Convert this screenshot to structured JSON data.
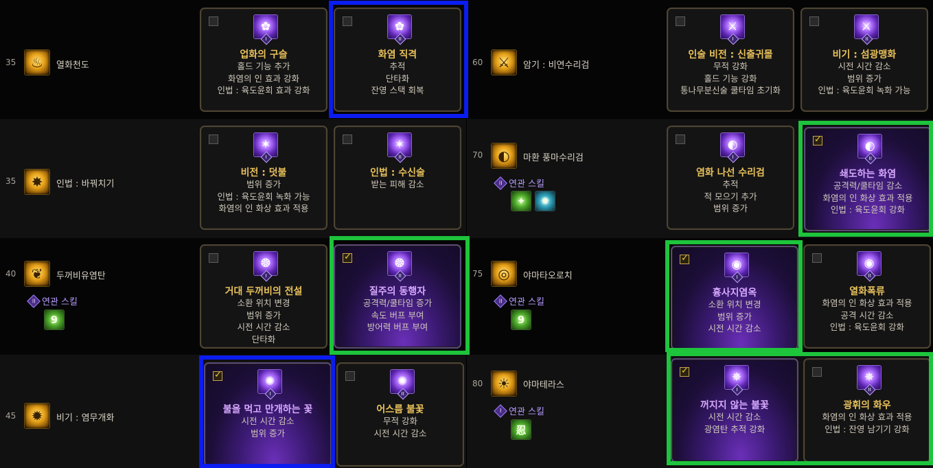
{
  "colors": {
    "highlight_blue": "#0b1cf0",
    "highlight_green": "#1ec43c",
    "title_gold": "#e8c15a",
    "title_selected": "#d7a8ff",
    "related_purple": "#b79cff"
  },
  "left": {
    "rows": [
      {
        "level": "35",
        "skill": "열화천도",
        "icon": "fire-skill-icon",
        "cards": [
          {
            "title": "업화의 구슬",
            "rank": "I",
            "checked": false,
            "selected": false,
            "lines": [
              "홀드 기능 추가",
              "화염의 인 효과 강화",
              "인법 : 육도윤회 효과 강화"
            ]
          },
          {
            "title": "화염 직격",
            "rank": "II",
            "checked": false,
            "selected": false,
            "lines": [
              "추적",
              "단타화",
              "잔영 스택 회복"
            ]
          }
        ]
      },
      {
        "level": "35",
        "skill": "인법 : 바꿔치기",
        "icon": "swap-skill-icon",
        "cards": [
          {
            "title": "비전 : 덧불",
            "rank": "I",
            "checked": false,
            "selected": false,
            "lines": [
              "범위 증가",
              "인법 : 육도윤회 녹화 가능",
              "화염의 인 화상 효과 적용"
            ]
          },
          {
            "title": "인법 : 수신술",
            "rank": "II",
            "checked": false,
            "selected": false,
            "lines": [
              "받는 피해 감소"
            ]
          }
        ]
      },
      {
        "level": "40",
        "skill": "두꺼비유염탄",
        "icon": "toad-skill-icon",
        "related_label": "연관 스킬",
        "related_rank": "II",
        "related_icons": [
          "9"
        ],
        "cards": [
          {
            "title": "거대 두꺼비의 전설",
            "rank": "I",
            "checked": false,
            "selected": false,
            "lines": [
              "소환 위치 변경",
              "범위 증가",
              "시전 시간 감소",
              "단타화"
            ]
          },
          {
            "title": "질주의 동행자",
            "rank": "II",
            "checked": true,
            "selected": true,
            "lines": [
              "공격력/쿨타임 증가",
              "속도 버프 부여",
              "방어력 버프 부여"
            ]
          }
        ]
      },
      {
        "level": "45",
        "skill": "비기 : 염무개화",
        "icon": "bloom-skill-icon",
        "cards": [
          {
            "title": "불을 먹고 만개하는 꽃",
            "rank": "I",
            "checked": true,
            "selected": true,
            "lines": [
              "시전 시간 감소",
              "범위 증가"
            ]
          },
          {
            "title": "어스름 불꽃",
            "rank": "II",
            "checked": false,
            "selected": false,
            "lines": [
              "무적 강화",
              "시전 시간 감소"
            ]
          }
        ]
      }
    ]
  },
  "right": {
    "rows": [
      {
        "level": "60",
        "skill": "암기 : 비연수리검",
        "icon": "shuriken-skill-icon",
        "cards": [
          {
            "title": "인술 비전 : 신출귀몰",
            "rank": "I",
            "checked": false,
            "selected": false,
            "lines": [
              "무적 강화",
              "홀드 기능 강화",
              "통나무분신술 쿨타임 초기화"
            ]
          },
          {
            "title": "비기 : 섬광맹화",
            "rank": "II",
            "checked": false,
            "selected": false,
            "lines": [
              "시전 시간 감소",
              "범위 증가",
              "인법 : 육도윤회 녹화 가능"
            ]
          }
        ]
      },
      {
        "level": "70",
        "skill": "마환 풍마수리검",
        "icon": "wind-shuriken-skill-icon",
        "related_label": "연관 스킬",
        "related_rank": "II",
        "related_icons": [
          "✦",
          "✺"
        ],
        "cards": [
          {
            "title": "염화 나선 수리검",
            "rank": "I",
            "checked": false,
            "selected": false,
            "lines": [
              "추적",
              "적 모으기 추가",
              "범위 증가"
            ]
          },
          {
            "title": "쇄도하는 화염",
            "rank": "II",
            "checked": true,
            "selected": true,
            "lines": [
              "공격력/쿨타임 감소",
              "화염의 인 화상 효과 적용",
              "인법 : 육도윤회 강화"
            ]
          }
        ]
      },
      {
        "level": "75",
        "skill": "야마타오로치",
        "icon": "serpent-skill-icon",
        "related_label": "연관 스킬",
        "related_rank": "II",
        "related_icons": [
          "9"
        ],
        "cards": [
          {
            "title": "흉사지염옥",
            "rank": "I",
            "checked": true,
            "selected": true,
            "lines": [
              "소환 위치 변경",
              "범위 증가",
              "시전 시간 감소"
            ]
          },
          {
            "title": "열화폭류",
            "rank": "II",
            "checked": false,
            "selected": false,
            "lines": [
              "화염의 인 화상 효과 적용",
              "공격 시간 감소",
              "인법 : 육도윤회 강화"
            ]
          }
        ]
      },
      {
        "level": "80",
        "skill": "야마테라스",
        "icon": "sun-skill-icon",
        "related_label": "연관 스킬",
        "related_rank": "I",
        "related_icons": [
          "忍"
        ],
        "cards": [
          {
            "title": "꺼지지 않는 불꽃",
            "rank": "I",
            "checked": true,
            "selected": true,
            "lines": [
              "시전 시간 감소",
              "광염탄 추적 강화"
            ]
          },
          {
            "title": "광휘의 화우",
            "rank": "II",
            "checked": false,
            "selected": false,
            "lines": [
              "화염의 인 화상 효과 적용",
              "인법 : 잔영 남기기 강화"
            ]
          }
        ]
      }
    ]
  }
}
